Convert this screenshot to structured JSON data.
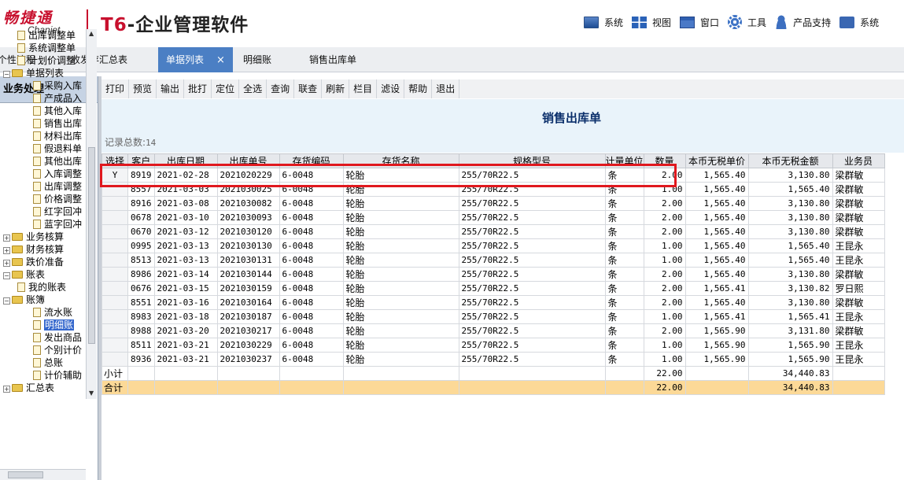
{
  "header": {
    "logo_cn": "畅捷通",
    "logo_en": "Chanjet",
    "title_t6": "T6",
    "title_rest": "-企业管理软件",
    "menu": [
      {
        "label": "系统",
        "icon": "monitor-icon"
      },
      {
        "label": "视图",
        "icon": "grid-icon"
      },
      {
        "label": "窗口",
        "icon": "window-icon"
      },
      {
        "label": "工具",
        "icon": "gear-icon"
      },
      {
        "label": "产品支持",
        "icon": "user-icon"
      },
      {
        "label": "系统",
        "icon": "system-icon"
      }
    ]
  },
  "tabs": [
    {
      "label": "个性流程"
    },
    {
      "label": "收发存汇总表"
    },
    {
      "label": "单据列表",
      "close": "×"
    },
    {
      "label": "明细账"
    },
    {
      "label": "销售出库单"
    }
  ],
  "sidebar": {
    "title": "业务处理",
    "tree": [
      {
        "label": "出库调整单",
        "kind": "doc"
      },
      {
        "label": "系统调整单",
        "kind": "doc"
      },
      {
        "label": "计划价调整",
        "kind": "doc"
      },
      {
        "label": "单据列表",
        "kind": "folder",
        "pm": "−"
      },
      {
        "label": "采购入库",
        "kind": "doc"
      },
      {
        "label": "产成品入",
        "kind": "doc"
      },
      {
        "label": "其他入库",
        "kind": "doc"
      },
      {
        "label": "销售出库",
        "kind": "doc"
      },
      {
        "label": "材料出库",
        "kind": "doc"
      },
      {
        "label": "假退料单",
        "kind": "doc"
      },
      {
        "label": "其他出库",
        "kind": "doc"
      },
      {
        "label": "入库调整",
        "kind": "doc"
      },
      {
        "label": "出库调整",
        "kind": "doc"
      },
      {
        "label": "价格调整",
        "kind": "doc"
      },
      {
        "label": "红字回冲",
        "kind": "doc"
      },
      {
        "label": "蓝字回冲",
        "kind": "doc"
      },
      {
        "label": "业务核算",
        "kind": "folder",
        "pm": "+"
      },
      {
        "label": "财务核算",
        "kind": "folder",
        "pm": "+"
      },
      {
        "label": "跌价准备",
        "kind": "folder",
        "pm": "+"
      },
      {
        "label": "账表",
        "kind": "folder",
        "pm": "−"
      },
      {
        "label": "我的账表",
        "kind": "doc"
      },
      {
        "label": "账簿",
        "kind": "folder",
        "pm": "−"
      },
      {
        "label": "流水账",
        "kind": "doc"
      },
      {
        "label": "明细账",
        "kind": "doc",
        "selected": true
      },
      {
        "label": "发出商品",
        "kind": "doc"
      },
      {
        "label": "个别计价",
        "kind": "doc"
      },
      {
        "label": "总账",
        "kind": "doc"
      },
      {
        "label": "计价辅助",
        "kind": "doc"
      },
      {
        "label": "汇总表",
        "kind": "folder",
        "pm": "+"
      }
    ]
  },
  "toolbar": [
    "打印",
    "预览",
    "输出",
    "批打",
    "定位",
    "全选",
    "查询",
    "联查",
    "刷新",
    "栏目",
    "滤设",
    "帮助",
    "退出"
  ],
  "document": {
    "title": "销售出库单",
    "record_label": "记录总数:",
    "record_count": "14"
  },
  "grid": {
    "columns": [
      "选择",
      "客户",
      "出库日期",
      "出库单号",
      "存货编码",
      "存货名称",
      "规格型号",
      "计量单位",
      "数量",
      "本币无税单价",
      "本币无税金额",
      "业务员"
    ],
    "rows": [
      [
        "Y",
        "8919",
        "2021-02-28",
        "2021020229",
        "6-0048",
        "轮胎",
        "255/70R22.5",
        "条",
        "2.00",
        "1,565.40",
        "3,130.80",
        "梁群敏"
      ],
      [
        "",
        "8557",
        "2021-03-03",
        "2021030025",
        "6-0048",
        "轮胎",
        "255/70R22.5",
        "条",
        "1.00",
        "1,565.40",
        "1,565.40",
        "梁群敏"
      ],
      [
        "",
        "8916",
        "2021-03-08",
        "2021030082",
        "6-0048",
        "轮胎",
        "255/70R22.5",
        "条",
        "2.00",
        "1,565.40",
        "3,130.80",
        "梁群敏"
      ],
      [
        "",
        "0678",
        "2021-03-10",
        "2021030093",
        "6-0048",
        "轮胎",
        "255/70R22.5",
        "条",
        "2.00",
        "1,565.40",
        "3,130.80",
        "梁群敏"
      ],
      [
        "",
        "0670",
        "2021-03-12",
        "2021030120",
        "6-0048",
        "轮胎",
        "255/70R22.5",
        "条",
        "2.00",
        "1,565.40",
        "3,130.80",
        "梁群敏"
      ],
      [
        "",
        "0995",
        "2021-03-13",
        "2021030130",
        "6-0048",
        "轮胎",
        "255/70R22.5",
        "条",
        "1.00",
        "1,565.40",
        "1,565.40",
        "王昆永"
      ],
      [
        "",
        "8513",
        "2021-03-13",
        "2021030131",
        "6-0048",
        "轮胎",
        "255/70R22.5",
        "条",
        "1.00",
        "1,565.40",
        "1,565.40",
        "王昆永"
      ],
      [
        "",
        "8986",
        "2021-03-14",
        "2021030144",
        "6-0048",
        "轮胎",
        "255/70R22.5",
        "条",
        "2.00",
        "1,565.40",
        "3,130.80",
        "梁群敏"
      ],
      [
        "",
        "0676",
        "2021-03-15",
        "2021030159",
        "6-0048",
        "轮胎",
        "255/70R22.5",
        "条",
        "2.00",
        "1,565.41",
        "3,130.82",
        "罗日熙"
      ],
      [
        "",
        "8551",
        "2021-03-16",
        "2021030164",
        "6-0048",
        "轮胎",
        "255/70R22.5",
        "条",
        "2.00",
        "1,565.40",
        "3,130.80",
        "梁群敏"
      ],
      [
        "",
        "8983",
        "2021-03-18",
        "2021030187",
        "6-0048",
        "轮胎",
        "255/70R22.5",
        "条",
        "1.00",
        "1,565.41",
        "1,565.41",
        "王昆永"
      ],
      [
        "",
        "8988",
        "2021-03-20",
        "2021030217",
        "6-0048",
        "轮胎",
        "255/70R22.5",
        "条",
        "2.00",
        "1,565.90",
        "3,131.80",
        "梁群敏"
      ],
      [
        "",
        "8511",
        "2021-03-21",
        "2021030229",
        "6-0048",
        "轮胎",
        "255/70R22.5",
        "条",
        "1.00",
        "1,565.90",
        "1,565.90",
        "王昆永"
      ],
      [
        "",
        "8936",
        "2021-03-21",
        "2021030237",
        "6-0048",
        "轮胎",
        "255/70R22.5",
        "条",
        "1.00",
        "1,565.90",
        "1,565.90",
        "王昆永"
      ]
    ],
    "subtotal": {
      "label": "小计",
      "quantity": "22.00",
      "amount": "34,440.83"
    },
    "total": {
      "label": "合计",
      "quantity": "22.00",
      "amount": "34,440.83"
    }
  },
  "colors": {
    "accent": "#4b7fc4",
    "total_row": "#fcd997",
    "highlight": "#e0181e",
    "brand_red": "#c8102e"
  }
}
